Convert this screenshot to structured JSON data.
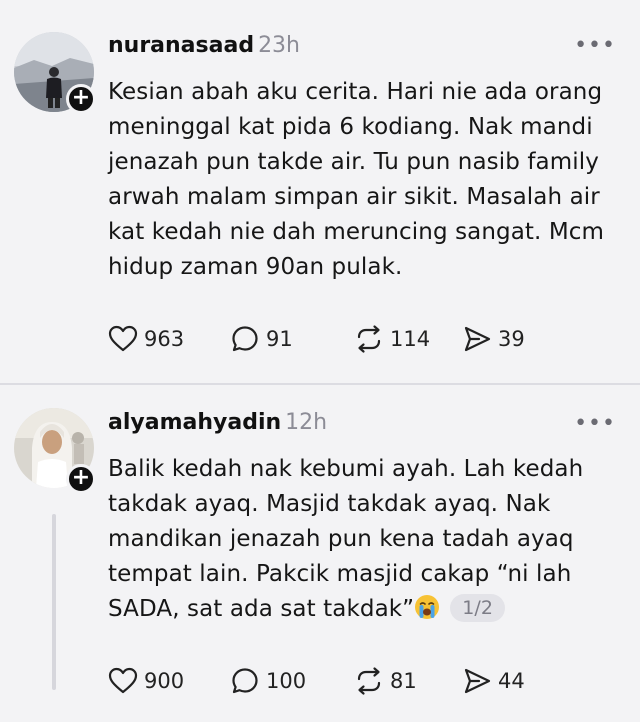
{
  "posts": [
    {
      "username": "nuranasaad",
      "time": "23h",
      "body_lines": [
        "Kesian abah aku cerita. Hari nie ada orang",
        "meninggal kat pida 6 kodiang. Nak mandi",
        "jenazah pun takde air. Tu pun nasib family",
        "arwah malam simpan air sikit. Masalah air",
        "kat kedah nie dah meruncing sangat. Mcm",
        "hidup zaman 90an pulak."
      ],
      "likes": "963",
      "replies": "91",
      "reposts": "114",
      "shares": "39"
    },
    {
      "username": "alyamahyadin",
      "time": "12h",
      "body_lines": [
        "Balik kedah nak kebumi ayah. Lah kedah",
        "takdak ayaq. Masjid takdak ayaq. Nak",
        "mandikan jenazah pun kena tadah ayaq",
        "tempat lain. Pakcik masjid cakap “ni lah",
        "SADA, sat ada sat takdak”"
      ],
      "emoji": "crying-face",
      "pager": "1/2",
      "likes": "900",
      "replies": "100",
      "reposts": "81",
      "shares": "44"
    }
  ],
  "icons": {
    "follow": "+",
    "more": "•••"
  }
}
